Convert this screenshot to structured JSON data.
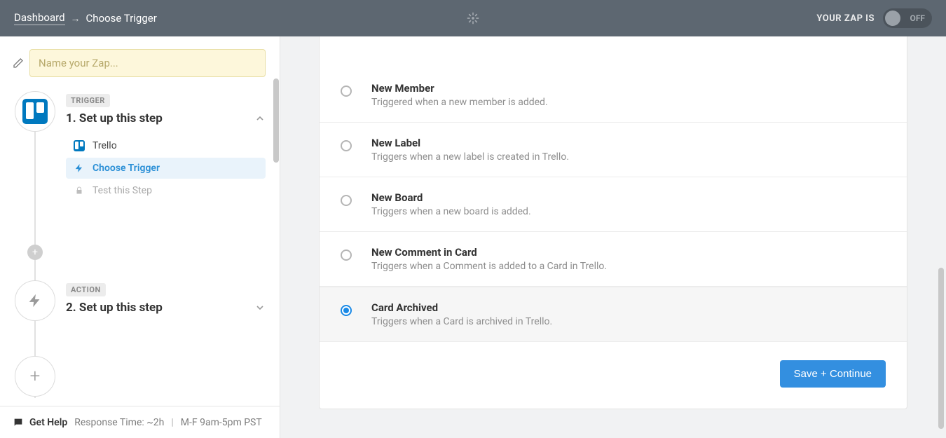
{
  "header": {
    "breadcrumb_dashboard": "Dashboard",
    "breadcrumb_current": "Choose Trigger",
    "status_label": "YOUR ZAP IS",
    "toggle_label": "OFF"
  },
  "zap": {
    "name_placeholder": "Name your Zap..."
  },
  "steps": {
    "trigger_tag": "TRIGGER",
    "action_tag": "ACTION",
    "step1_title": "1. Set up this step",
    "step2_title": "2. Set up this step",
    "substeps": {
      "app": "Trello",
      "choose_trigger": "Choose Trigger",
      "test": "Test this Step"
    }
  },
  "options": [
    {
      "title": "New Member",
      "desc": "Triggered when a new member is added.",
      "selected": false
    },
    {
      "title": "New Label",
      "desc": "Triggers when a new label is created in Trello.",
      "selected": false
    },
    {
      "title": "New Board",
      "desc": "Triggers when a new board is added.",
      "selected": false
    },
    {
      "title": "New Comment in Card",
      "desc": "Triggers when a Comment is added to a Card in Trello.",
      "selected": false
    },
    {
      "title": "Card Archived",
      "desc": "Triggers when a Card is archived in Trello.",
      "selected": true
    }
  ],
  "buttons": {
    "save_continue": "Save + Continue"
  },
  "footer": {
    "get_help": "Get Help",
    "response_time": "Response Time: ~2h",
    "hours": "M-F 9am-5pm PST"
  }
}
